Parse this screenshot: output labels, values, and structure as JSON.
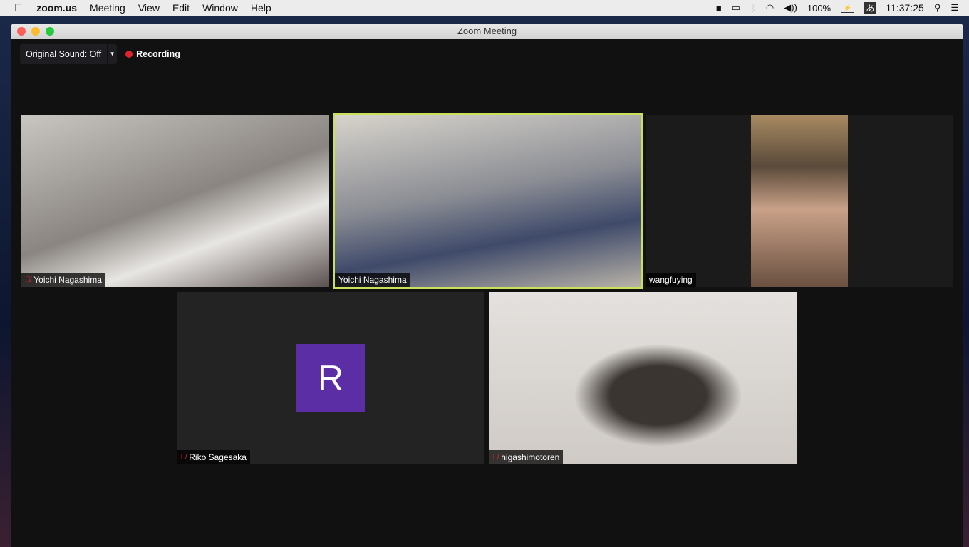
{
  "menubar": {
    "app": "zoom.us",
    "items": [
      "Meeting",
      "View",
      "Edit",
      "Window",
      "Help"
    ],
    "battery": "100%",
    "input_method": "あ",
    "time": "11:37:25"
  },
  "window": {
    "title": "Zoom Meeting"
  },
  "toolbar": {
    "original_sound": "Original Sound: Off",
    "recording": "Recording"
  },
  "participants": [
    {
      "name": "Yoichi Nagashima",
      "muted": true
    },
    {
      "name": "Yoichi Nagashima",
      "muted": false,
      "active_speaker": true
    },
    {
      "name": "wangfuying",
      "muted": false
    },
    {
      "name": "Riko Sagesaka",
      "muted": true,
      "avatar_letter": "R",
      "avatar_color": "#5b2ea6"
    },
    {
      "name": "higashimotoren",
      "muted": true
    }
  ],
  "colors": {
    "active_border": "#c8e05a",
    "recording": "#e0242f"
  }
}
